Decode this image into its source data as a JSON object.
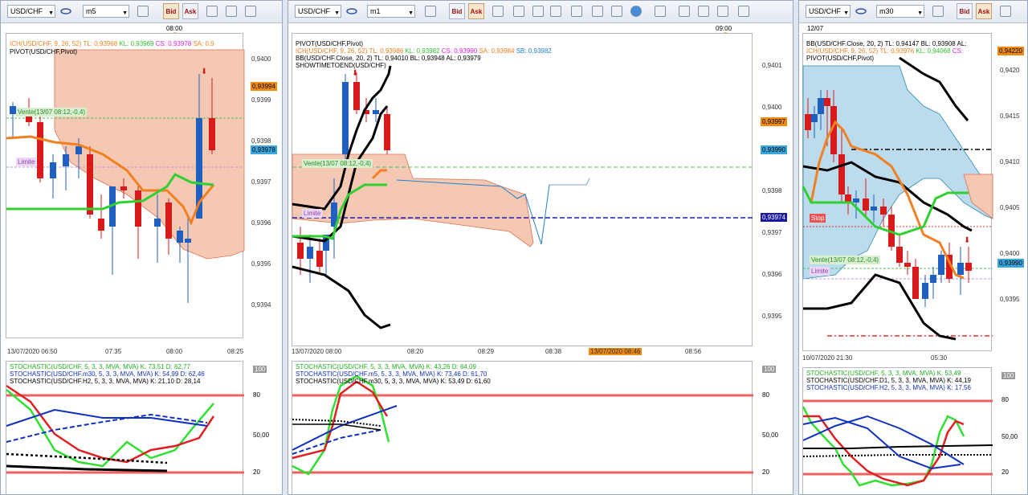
{
  "p1": {
    "symbol": "USD/CHF",
    "timeframe": "m5",
    "bid": "Bid",
    "ask": "Ask",
    "top_time": "08:00",
    "legend": [
      {
        "text": "ICH(USD/CHF, 9, 26, 52)",
        "color": "#f08020"
      },
      {
        "text": "TL: 0,93968",
        "color": "#f08020"
      },
      {
        "text": "KL: 0,93969",
        "color": "#30c030"
      },
      {
        "text": "CS: 0,93978",
        "color": "#e020e0"
      },
      {
        "text": "SA: 0,9",
        "color": "#f08020"
      }
    ],
    "legend2": "PIVOT(USD/CHF,Pivot)",
    "yticks": [
      "0,9400",
      "0,9399",
      "0,9398",
      "0,9397",
      "0,9396",
      "0,9395",
      "0,9394"
    ],
    "tag_price": "0,93994",
    "tag_bid": "0,93978",
    "sell_label": "Vente(13/07 08:12,-0,4)",
    "limit_label": "Limite",
    "xticks": [
      "13/07/2020 06:50",
      "07:35",
      "08:00",
      "08:25"
    ],
    "stoch": [
      {
        "text": "STOCHASTIC(USD/CHF, 5, 3, 3, MVA, MVA)   K: 73,51   D: 62,77",
        "color": "#20b020"
      },
      {
        "text": "STOCHASTIC(USD/CHF.m30, 5, 3, 3, MVA, MVA)   K: 54,99   D: 62,46",
        "color": "#1030c0"
      },
      {
        "text": "STOCHASTIC(USD/CHF.H2, 5, 3, 3, MVA, MVA)   K: 21,10   D: 28,14",
        "color": "#000000"
      }
    ],
    "ind_ticks": [
      "100",
      "80",
      "50,00",
      "20"
    ]
  },
  "p2": {
    "symbol": "USD/CHF",
    "timeframe": "m1",
    "bid": "Bid",
    "ask": "Ask",
    "top_time": "09:00",
    "legend_pivot": "PIVOT(USD/CHF,Pivot)",
    "legend": [
      {
        "text": "ICH(USD/CHF, 9, 26, 52)",
        "color": "#f08020"
      },
      {
        "text": "TL: 0,93986",
        "color": "#f08020"
      },
      {
        "text": "KL: 0,93982",
        "color": "#30c030"
      },
      {
        "text": "CS: 0,93990",
        "color": "#e020e0"
      },
      {
        "text": "SA: 0,93984",
        "color": "#f08020"
      },
      {
        "text": "SB: 0,93982",
        "color": "#2080d0"
      }
    ],
    "legend_bb": "BB(USD/CHF.Close, 20, 2)   TL: 0,94010   BL: 0,93948   AL: 0,93979",
    "legend_show": "SHOWTIMETOEND(USD/CHF)",
    "yticks": [
      "0,9401",
      "0,9400",
      "0,9399",
      "0,9398",
      "0,9397",
      "0,9396",
      "0,9395"
    ],
    "tag_price": "0,93997",
    "tag_bid": "0,93990",
    "tag_pivot": "0,93974",
    "sell_label": "Vente(13/07 08:12,-0,4)",
    "limit_label": "Limite",
    "xticks": [
      "13/07/2020 08:00",
      "08:20",
      "08:29",
      "08:38",
      "08:56"
    ],
    "x_highlight": "13/07/2020 08:46",
    "stoch": [
      {
        "text": "STOCHASTIC(USD/CHF, 5, 3, 3, MVA, MVA)   K: 43,26   D: 64,09",
        "color": "#20b020"
      },
      {
        "text": "STOCHASTIC(USD/CHF.m5, 5, 3, 3, MVA, MVA)   K: 73,46   D: 61,70",
        "color": "#1030c0"
      },
      {
        "text": "STOCHASTIC(USD/CHF.m30, 5, 3, 3, MVA, MVA)   K: 53,49   D: 61,60",
        "color": "#000000"
      }
    ],
    "ind_ticks": [
      "100",
      "80",
      "50,00",
      "20"
    ]
  },
  "p3": {
    "symbol": "USD/CHF",
    "timeframe": "m30",
    "bid": "Bid",
    "ask": "Ask",
    "top_time": "12/07",
    "legend_bb": "BB(USD/CHF.Close, 20, 2)   TL: 0,94147   BL: 0,93908   AL:",
    "legend": [
      {
        "text": "ICH(USD/CHF, 9, 26, 52)",
        "color": "#f08020"
      },
      {
        "text": "TL: 0,93976",
        "color": "#f08020"
      },
      {
        "text": "KL: 0,94068",
        "color": "#30c030"
      },
      {
        "text": "CS:",
        "color": "#e020e0"
      }
    ],
    "legend_pivot": "PIVOT(USD/CHF,Pivot)",
    "yticks": [
      "0,9420",
      "0,9415",
      "0,9410",
      "0,9405",
      "0,9400",
      "0,9395"
    ],
    "tag_top": "0,94220",
    "tag_bid": "0,93990",
    "stop_label": "Stop",
    "sell_label": "Vente(13/07 08:12,-0,4)",
    "limit_label": "Limite",
    "xticks": [
      "10/07/2020 21:30",
      "05:30"
    ],
    "stoch": [
      {
        "text": "STOCHASTIC(USD/CHF, 5, 3, 3, MVA, MVA)   K: 53,49",
        "color": "#20b020"
      },
      {
        "text": "STOCHASTIC(USD/CHF.D1, 5, 3, 3, MVA, MVA)   K: 44,19",
        "color": "#000000"
      },
      {
        "text": "STOCHASTIC(USD/CHF.H2, 5, 3, 3, MVA, MVA)   K: 17,56",
        "color": "#1030c0"
      }
    ],
    "ind_ticks": [
      "100",
      "80",
      "50,00",
      "20"
    ]
  },
  "colors": {
    "bull": "#1f5fbf",
    "bear": "#d81a1a",
    "tenkan": "#f08020",
    "kijun": "#30d030",
    "cloud": "#f5c8b4",
    "cloud_blue": "#bcdcee",
    "level80": "#f06060"
  }
}
